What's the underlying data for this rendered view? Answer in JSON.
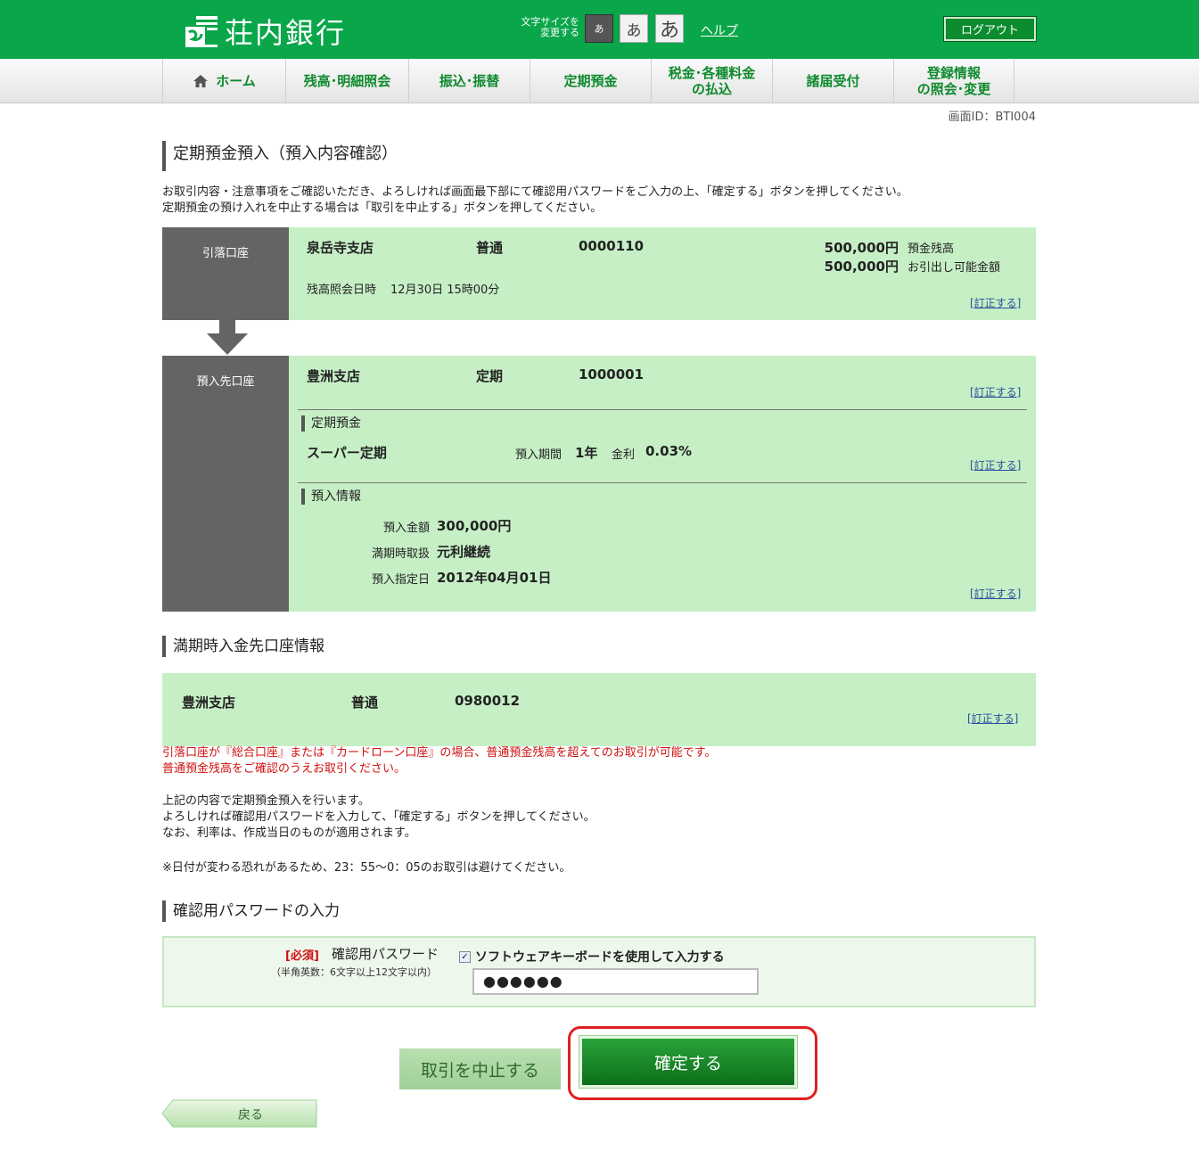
{
  "header": {
    "bank_name": "荘内銀行",
    "font_size_label_1": "文字サイズを",
    "font_size_label_2": "変更する",
    "font_small": "あ",
    "font_medium": "あ",
    "font_large": "あ",
    "help": "ヘルプ",
    "logout": "ログアウト"
  },
  "nav": {
    "home": "ホーム",
    "balance": "残高･明細照会",
    "transfer": "振込･振替",
    "deposit": "定期預金",
    "tax_1": "税金･各種料金",
    "tax_2": "の払込",
    "notice": "諸届受付",
    "register_1": "登録情報",
    "register_2": "の照会･変更"
  },
  "screen_id": "画面ID：BTI004",
  "page_title": "定期預金預入（預入内容確認）",
  "intro": [
    "お取引内容・注意事項をご確認いただき、よろしければ画面最下部にて確認用パスワードをご入力の上、「確定する」ボタンを押してください。",
    "定期預金の預け入れを中止する場合は「取引を中止する」ボタンを押してください。"
  ],
  "from_account": {
    "label": "引落口座",
    "branch": "泉岳寺支店",
    "type": "普通",
    "number": "0000110",
    "balance": "500,000円",
    "balance_label": "預金残高",
    "available": "500,000円",
    "available_label": "お引出し可能金額",
    "query_label": "残高照会日時",
    "query_datetime": "12月30日 15時00分",
    "edit": "[訂正する]"
  },
  "to_account": {
    "label": "預入先口座",
    "branch": "豊洲支店",
    "type": "定期",
    "number": "1000001",
    "edit": "[訂正する]",
    "deposit_section": "定期預金",
    "product": "スーパー定期",
    "period_label": "預入期間",
    "period": "1年",
    "rate_label": "金利",
    "rate": "0.03%",
    "deposit_edit": "[訂正する]",
    "info_section": "預入情報",
    "amount_label": "預入金額",
    "amount": "300,000円",
    "maturity_label": "満期時取扱",
    "maturity": "元利継続",
    "date_label": "預入指定日",
    "date": "2012年04月01日",
    "info_edit": "[訂正する]"
  },
  "maturity_account": {
    "title": "満期時入金先口座情報",
    "branch": "豊洲支店",
    "type": "普通",
    "number": "0980012",
    "edit": "[訂正する]"
  },
  "notice_red": [
    "引落口座が『総合口座』または『カードローン口座』の場合、普通預金残高を超えてのお取引が可能です。",
    "普通預金残高をご確認のうえお取引ください。"
  ],
  "info_text": [
    "上記の内容で定期預金預入を行います。",
    "よろしければ確認用パスワードを入力して、「確定する」ボタンを押してください。",
    "なお、利率は、作成当日のものが適用されます。"
  ],
  "date_note": "※日付が変わる恐れがあるため、23：55〜0：05のお取引は避けてください。",
  "password": {
    "title": "確認用パスワードの入力",
    "required": "[必須]",
    "label": "確認用パスワード",
    "hint": "（半角英数：6文字以上12文字以内）",
    "checkbox_label": "ソフトウェアキーボードを使用して入力する",
    "value": "●●●●●●"
  },
  "buttons": {
    "cancel": "取引を中止する",
    "confirm": "確定する",
    "back": "戻る"
  },
  "colors": {
    "header_green": "#0aa64a",
    "panel_green": "#c6efc5",
    "label_gray": "#646464",
    "highlight_red": "#e02020"
  }
}
